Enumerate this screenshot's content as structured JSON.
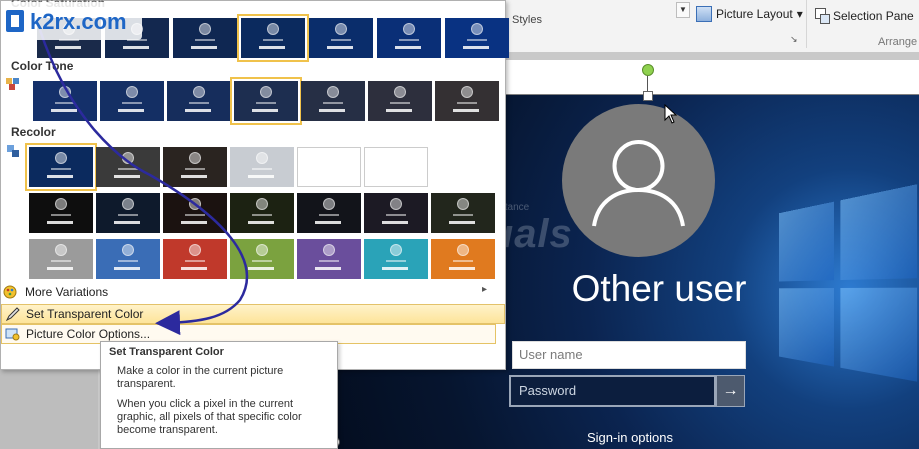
{
  "ribbon": {
    "styles_label": "Styles",
    "styles_more": "▼",
    "picture_layout_label": "Picture Layout",
    "picture_layout_arrow": "▾",
    "dialog_launcher": "↘",
    "selection_pane_label": "Selection Pane",
    "arrange_label": "Arrange"
  },
  "panel": {
    "saturation_title": "Color Saturation",
    "tone_title": "Color Tone",
    "recolor_title": "Recolor",
    "more_variations": "More Variations",
    "set_transparent_color": "Set Transparent Color",
    "picture_color_options": "Picture Color Options...",
    "submenu_arrow": "▸",
    "thumbnail_label": "Other user",
    "saturation_row": [
      {
        "color": "#1a2a4a",
        "selected": false
      },
      {
        "color": "#13284f",
        "selected": false
      },
      {
        "color": "#0f2752",
        "selected": false
      },
      {
        "color": "#0b2a5e",
        "selected": true
      },
      {
        "color": "#0a2d6b",
        "selected": false
      },
      {
        "color": "#0a2f77",
        "selected": false
      },
      {
        "color": "#093282",
        "selected": false
      }
    ],
    "tone_row": [
      {
        "color": "#14306a",
        "selected": false
      },
      {
        "color": "#142f64",
        "selected": false
      },
      {
        "color": "#162d5c",
        "selected": false
      },
      {
        "color": "#1d2e50",
        "selected": true
      },
      {
        "color": "#262f45",
        "selected": false
      },
      {
        "color": "#2d2f3d",
        "selected": false
      },
      {
        "color": "#343033",
        "selected": false
      }
    ],
    "recolor_rows": [
      [
        {
          "color": "#0b2a5e",
          "selected": true
        },
        {
          "color": "#3a3a3a",
          "selected": false
        },
        {
          "color": "#2a2420",
          "selected": false
        },
        {
          "color": "#c8ccd2",
          "selected": false
        },
        {
          "color": "#ffffff",
          "selected": false
        },
        {
          "color": "#ffffff",
          "selected": false
        }
      ],
      [
        {
          "color": "#0e0e0e",
          "selected": false
        },
        {
          "color": "#0e1a2c",
          "selected": false
        },
        {
          "color": "#1b1210",
          "selected": false
        },
        {
          "color": "#1c2212",
          "selected": false
        },
        {
          "color": "#12141a",
          "selected": false
        },
        {
          "color": "#1c1a24",
          "selected": false
        },
        {
          "color": "#22261c",
          "selected": false
        }
      ],
      [
        {
          "color": "#9b9b9b",
          "selected": false
        },
        {
          "color": "#3a6db6",
          "selected": false
        },
        {
          "color": "#c0392b",
          "selected": false
        },
        {
          "color": "#7ba23f",
          "selected": false
        },
        {
          "color": "#6a4e9c",
          "selected": false
        },
        {
          "color": "#2aa3b8",
          "selected": false
        },
        {
          "color": "#e07a1f",
          "selected": false
        }
      ]
    ]
  },
  "tooltip": {
    "title": "Set Transparent Color",
    "line1": "Make a color in the current picture transparent.",
    "line2": "When you click a pixel in the current graphic, all pixels of that specific color become transparent."
  },
  "lockscreen": {
    "username": "Other user",
    "user_name_placeholder": "User name",
    "password_placeholder": "Password",
    "submit_arrow": "→",
    "sign_in_options": "Sign-in options"
  },
  "watermark": {
    "brand": "Appuals",
    "tagline": "Expert Tech Assistance"
  },
  "site_logo": "k2rx.com",
  "colors": {
    "selected_outline": "#f0c24b",
    "annotation_arrow": "#2c2a9e",
    "menu_highlight": "#fde49a"
  }
}
